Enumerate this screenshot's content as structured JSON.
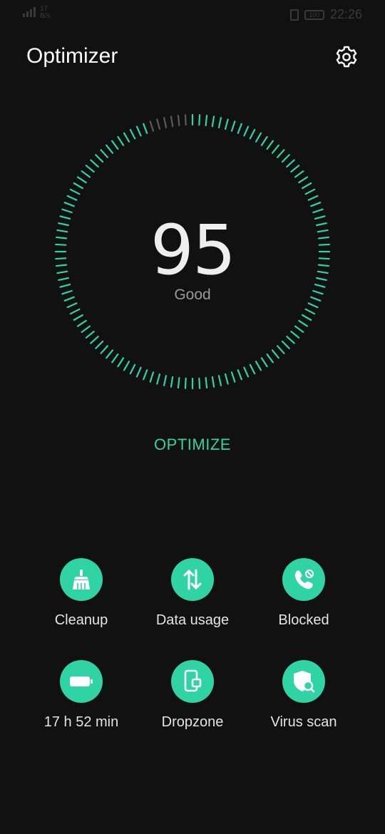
{
  "status_bar": {
    "speed_value": "17",
    "speed_unit": "B/s",
    "battery_level": "100",
    "time": "22:26"
  },
  "header": {
    "title": "Optimizer",
    "settings_icon": "gear-icon"
  },
  "score": {
    "value": "95",
    "label": "Good",
    "fraction": 0.95
  },
  "actions": {
    "optimize_label": "OPTIMIZE"
  },
  "tools": [
    {
      "label": "Cleanup",
      "icon": "broom-icon"
    },
    {
      "label": "Data usage",
      "icon": "data-transfer-icon"
    },
    {
      "label": "Blocked",
      "icon": "blocked-call-icon"
    },
    {
      "label": "17 h 52 min",
      "icon": "battery-icon"
    },
    {
      "label": "Dropzone",
      "icon": "dropzone-icon"
    },
    {
      "label": "Virus scan",
      "icon": "virus-scan-icon"
    }
  ],
  "colors": {
    "accent": "#2fd3a4",
    "background": "#111111",
    "tick_inactive": "#5a5a5a"
  }
}
